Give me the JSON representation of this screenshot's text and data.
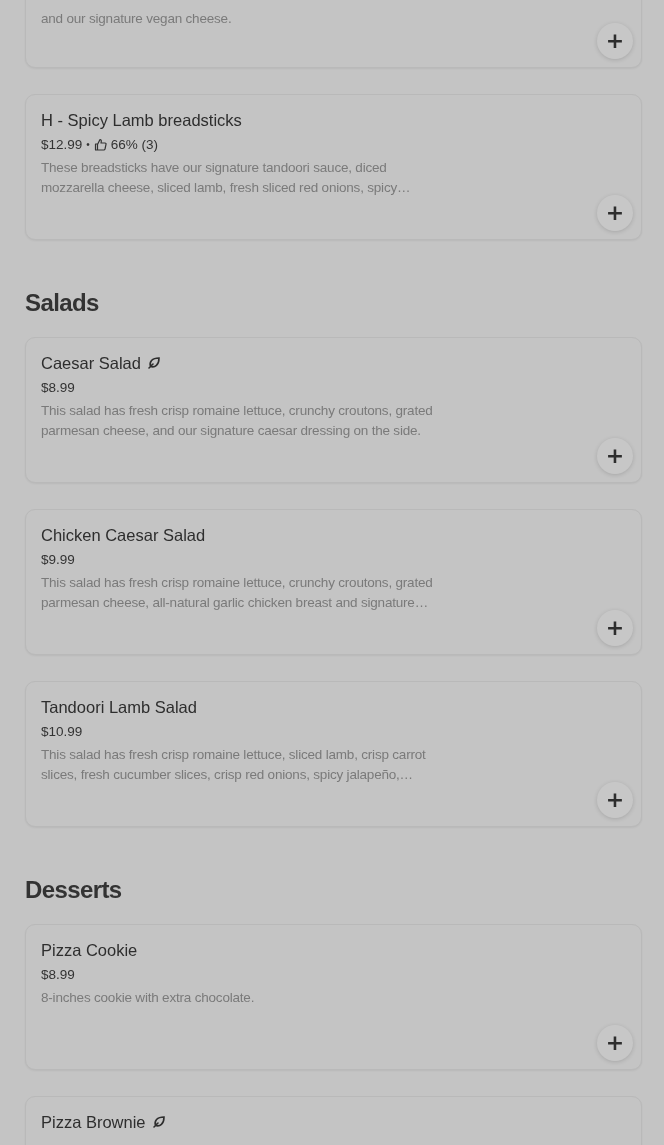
{
  "sections": [
    {
      "items": [
        {
          "kind": "partial",
          "description": "and our signature vegan cheese.",
          "add": "+"
        }
      ]
    },
    {
      "items": [
        {
          "kind": "full",
          "name": "H - Spicy Lamb breadsticks",
          "vegetarian": false,
          "price": "$12.99",
          "separator": "•",
          "rating": "66% (3)",
          "description": "These breadsticks have our signature tandoori sauce, diced\nmozzarella cheese, sliced lamb, fresh sliced red onions, spicy…",
          "add": "+"
        }
      ]
    },
    {
      "heading": "Salads",
      "items": [
        {
          "kind": "full",
          "name": "Caesar Salad",
          "vegetarian": true,
          "price": "$8.99",
          "description": "This salad has fresh crisp romaine lettuce, crunchy croutons, grated\nparmesan cheese, and our signature caesar dressing on the side.",
          "add": "+"
        },
        {
          "kind": "full",
          "name": "Chicken Caesar Salad",
          "vegetarian": false,
          "price": "$9.99",
          "description": "This salad has fresh crisp romaine lettuce, crunchy croutons, grated\nparmesan cheese, all-natural garlic chicken breast and signature…",
          "add": "+"
        },
        {
          "kind": "full",
          "name": "Tandoori Lamb Salad",
          "vegetarian": false,
          "price": "$10.99",
          "description": "This salad has fresh crisp romaine lettuce, sliced lamb, crisp carrot\nslices, fresh cucumber slices, crisp red onions, spicy jalapeño,…",
          "add": "+"
        }
      ]
    },
    {
      "heading": "Desserts",
      "items": [
        {
          "kind": "full",
          "name": "Pizza Cookie",
          "vegetarian": false,
          "price": "$8.99",
          "description": "8-inches cookie with extra chocolate.",
          "add": "+"
        },
        {
          "kind": "full",
          "name": "Pizza Brownie",
          "vegetarian": true
        }
      ]
    }
  ]
}
